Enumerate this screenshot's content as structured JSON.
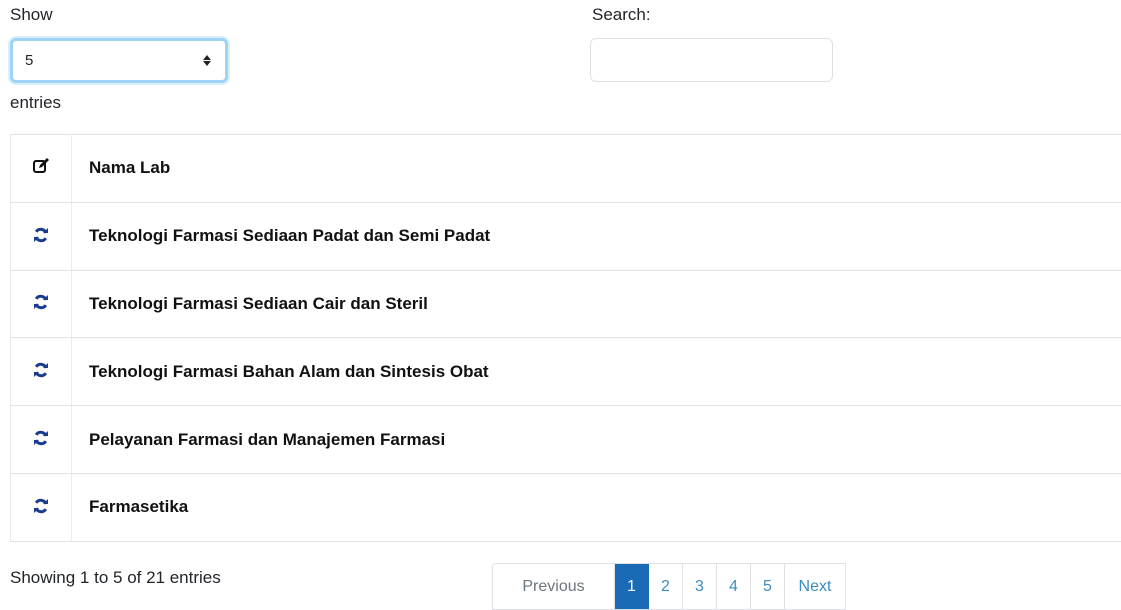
{
  "length": {
    "show_label": "Show",
    "selected": "5",
    "entries_label": "entries"
  },
  "search": {
    "label": "Search:",
    "value": "",
    "placeholder": ""
  },
  "table": {
    "header_icon": "edit-icon",
    "header": "Nama Lab",
    "row_icon": "refresh-icon",
    "rows": [
      "Teknologi Farmasi Sediaan Padat dan Semi Padat",
      "Teknologi Farmasi Sediaan Cair dan Steril",
      "Teknologi Farmasi Bahan Alam dan Sintesis Obat",
      "Pelayanan Farmasi dan Manajemen Farmasi",
      "Farmasetika"
    ]
  },
  "info": "Showing 1 to 5 of 21 entries",
  "pagination": {
    "previous": "Previous",
    "pages": [
      "1",
      "2",
      "3",
      "4",
      "5"
    ],
    "active_page": "1",
    "next": "Next"
  },
  "colors": {
    "accent": "#1a6bb5",
    "link": "#3c8dbc",
    "icon": "#1a3c8c",
    "select_focus": "#9fd3f5"
  }
}
